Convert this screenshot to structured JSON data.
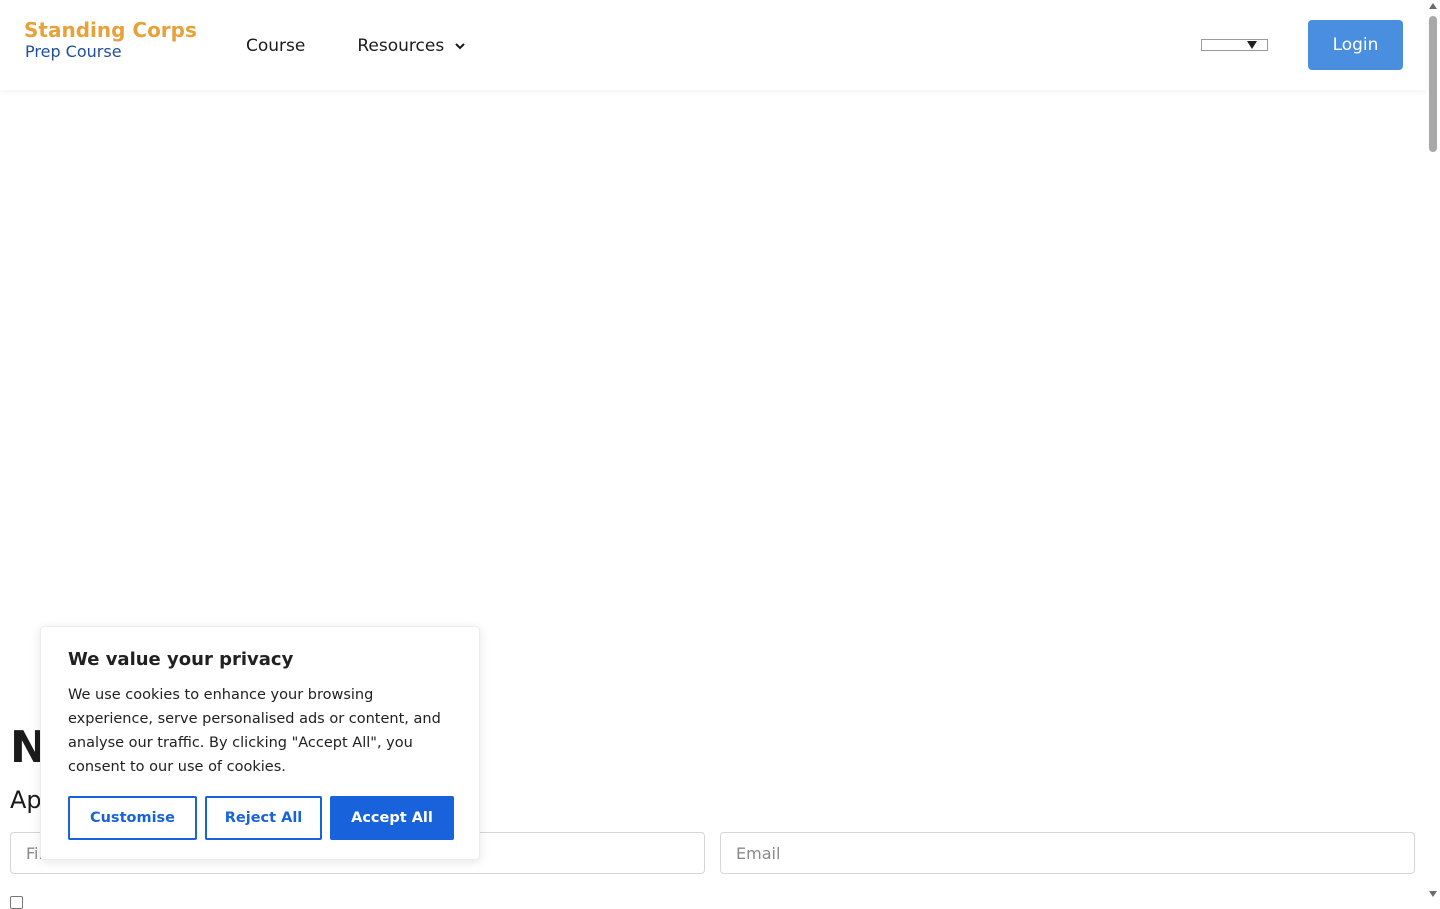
{
  "header": {
    "logo_top": "Standing Corps",
    "logo_bottom": "Prep Course",
    "nav": [
      {
        "label": "Course"
      },
      {
        "label": "Resources"
      }
    ],
    "login_label": "Login",
    "language_value": ""
  },
  "content": {
    "heading_fragment": "N",
    "subheading_fragment": "Ap",
    "first_name_placeholder": "First Name",
    "email_placeholder": "Email"
  },
  "cookie_banner": {
    "title": "We value your privacy",
    "body": "We use cookies to enhance your browsing experience, serve personalised ads or content, and analyse our traffic. By clicking \"Accept All\", you consent to our use of cookies.",
    "customise_label": "Customise",
    "reject_label": "Reject All",
    "accept_label": "Accept All"
  },
  "colors": {
    "logo_gold": "#e8a23a",
    "logo_blue": "#1f4e9c",
    "login_blue": "#4a8ee0",
    "cookie_blue": "#1863dc"
  }
}
